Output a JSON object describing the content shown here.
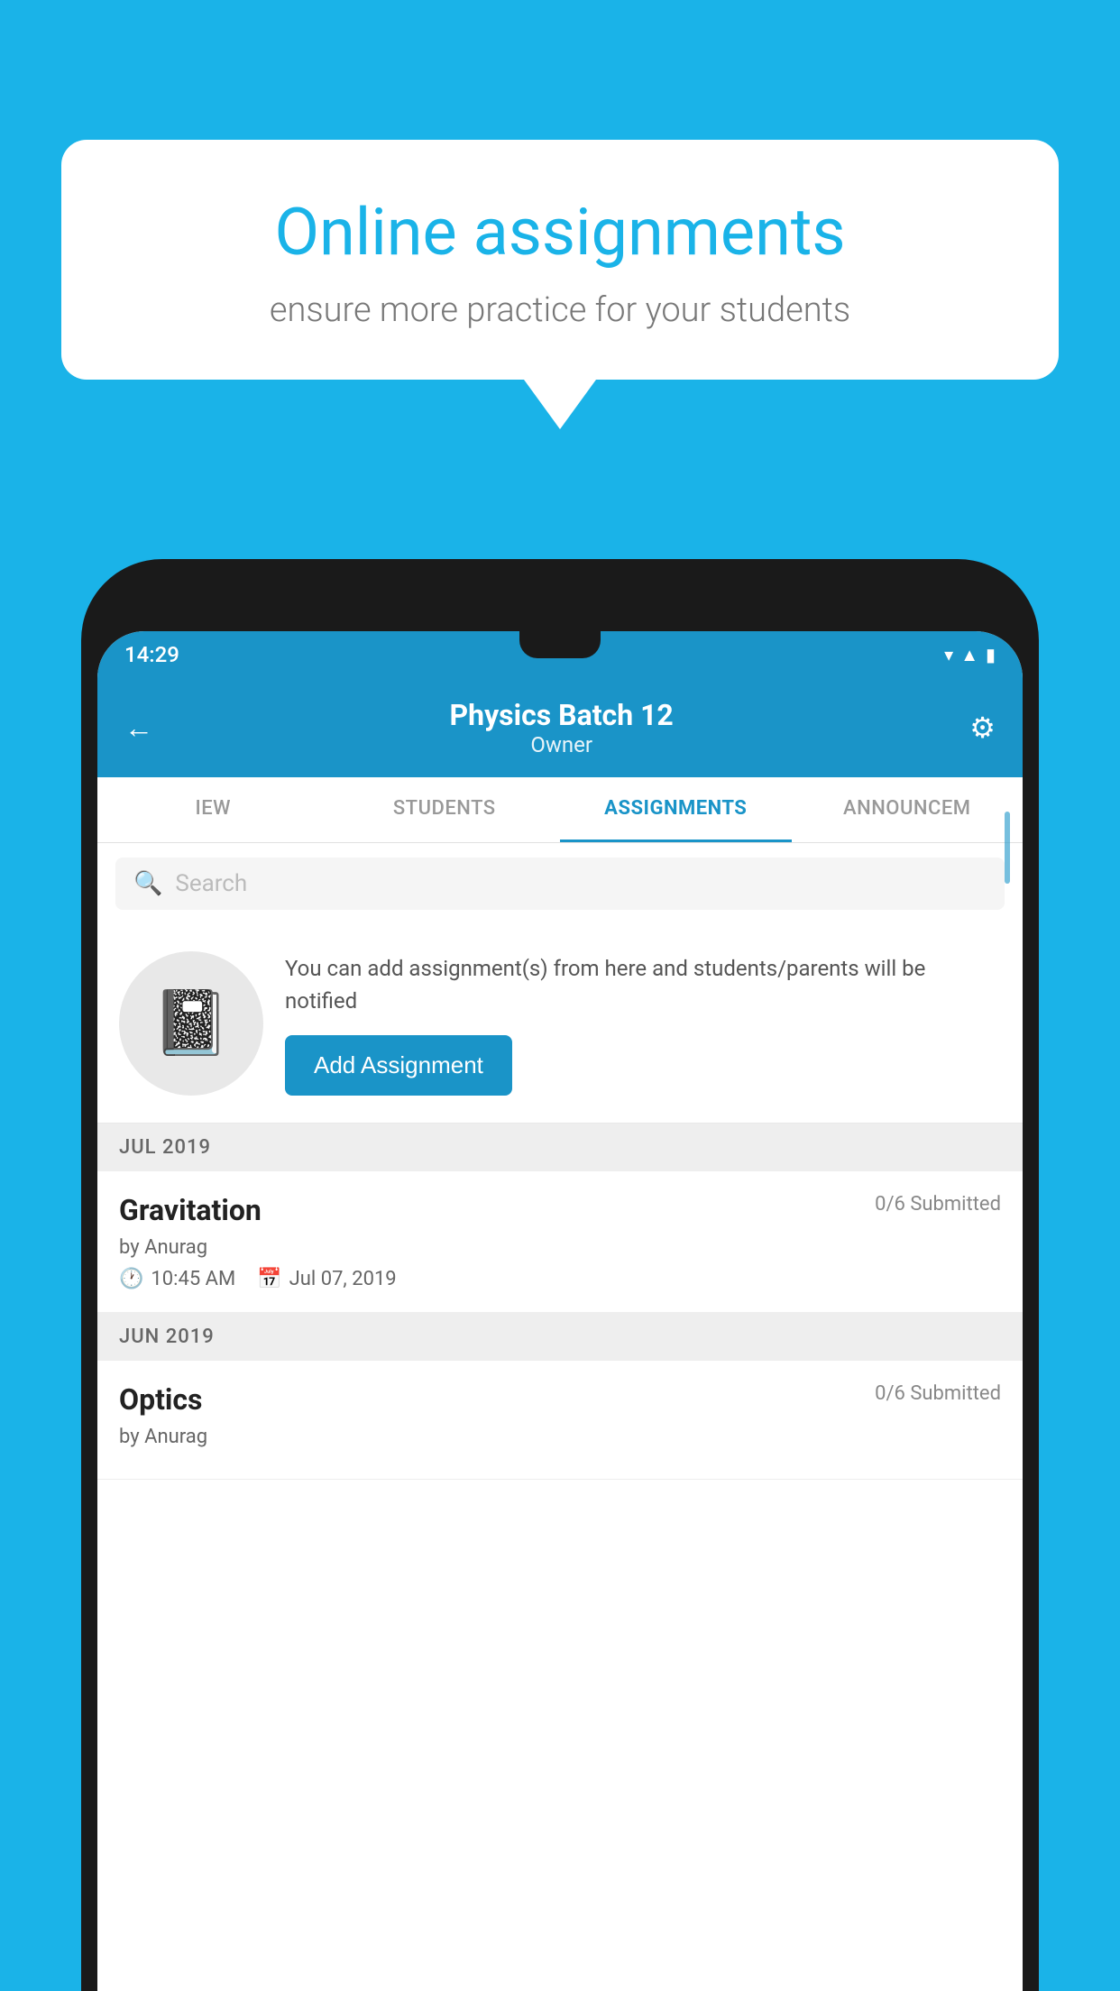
{
  "background": {
    "color": "#1ab3e8"
  },
  "speech_bubble": {
    "title": "Online assignments",
    "subtitle": "ensure more practice for your students"
  },
  "phone": {
    "status_bar": {
      "time": "14:29",
      "icons": [
        "wifi",
        "signal",
        "battery"
      ]
    },
    "header": {
      "title": "Physics Batch 12",
      "subtitle": "Owner",
      "back_label": "←",
      "settings_label": "⚙"
    },
    "tabs": [
      {
        "label": "IEW",
        "active": false
      },
      {
        "label": "STUDENTS",
        "active": false
      },
      {
        "label": "ASSIGNMENTS",
        "active": true
      },
      {
        "label": "ANNOUNCEM",
        "active": false
      }
    ],
    "search": {
      "placeholder": "Search"
    },
    "promo": {
      "icon": "📓",
      "text": "You can add assignment(s) from here and students/parents will be notified",
      "button_label": "Add Assignment"
    },
    "sections": [
      {
        "month_label": "JUL 2019",
        "assignments": [
          {
            "title": "Gravitation",
            "submitted": "0/6 Submitted",
            "author": "by Anurag",
            "time": "10:45 AM",
            "date": "Jul 07, 2019"
          }
        ]
      },
      {
        "month_label": "JUN 2019",
        "assignments": [
          {
            "title": "Optics",
            "submitted": "0/6 Submitted",
            "author": "by Anurag",
            "time": "",
            "date": ""
          }
        ]
      }
    ]
  }
}
